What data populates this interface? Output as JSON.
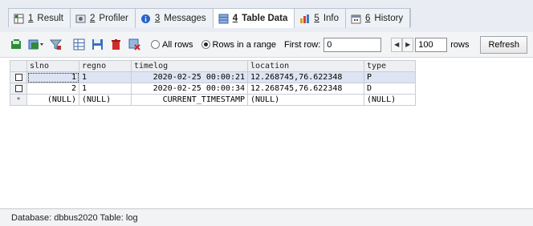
{
  "tabs": [
    {
      "num": "1",
      "label": "Result",
      "icon": "result-grid-icon",
      "active": false
    },
    {
      "num": "2",
      "label": "Profiler",
      "icon": "profiler-icon",
      "active": false
    },
    {
      "num": "3",
      "label": "Messages",
      "icon": "info-circle-icon",
      "active": false
    },
    {
      "num": "4",
      "label": "Table Data",
      "icon": "table-icon",
      "active": true
    },
    {
      "num": "5",
      "label": "Info",
      "icon": "info-icon",
      "active": false
    },
    {
      "num": "6",
      "label": "History",
      "icon": "calendar-icon",
      "active": false
    }
  ],
  "toolbar": {
    "radio_all": "All rows",
    "radio_range": "Rows in a range",
    "selected_mode": "range",
    "first_row_label": "First row:",
    "first_row_value": "0",
    "rows_value": "100",
    "rows_label": "rows",
    "refresh_label": "Refresh"
  },
  "grid": {
    "columns": [
      "slno",
      "regno",
      "timelog",
      "location",
      "type"
    ],
    "rows": [
      [
        "1",
        "1",
        "2020-02-25 00:00:21",
        "12.268745,76.622348",
        "P"
      ],
      [
        "2",
        "1",
        "2020-02-25 00:00:34",
        "12.268745,76.622348",
        "D"
      ],
      [
        "(NULL)",
        "(NULL)",
        "CURRENT_TIMESTAMP",
        "(NULL)",
        "(NULL)"
      ]
    ],
    "new_row_marker": "*"
  },
  "status": {
    "text": "Database: dbbus2020 Table: log"
  },
  "colors": {
    "tab_bar_bg": "#e9edf3",
    "highlight_row": "#dde4f3",
    "active_tab_bg": "#ffffff"
  }
}
